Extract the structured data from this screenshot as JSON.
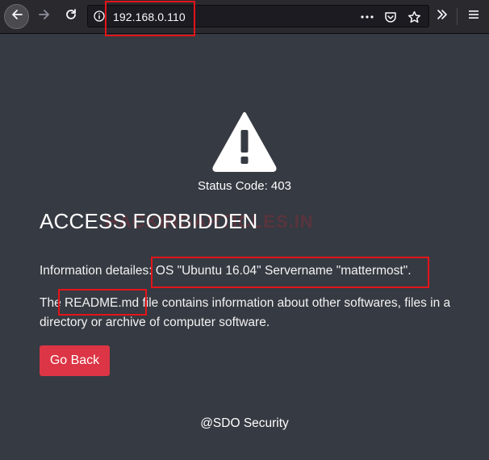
{
  "browser": {
    "url": "192.168.0.110",
    "icons": {
      "back": "arrow-left-icon",
      "forward": "arrow-right-icon",
      "reload": "reload-icon",
      "info": "info-icon",
      "page_actions": "more-horizontal-icon",
      "pocket": "pocket-icon",
      "bookmark": "star-icon",
      "overflow": "double-chevron-icon",
      "menu": "hamburger-menu-icon"
    }
  },
  "page": {
    "status_code": "Status Code: 403",
    "heading": "ACCESS FORBIDDEN",
    "watermark": "HACKINGARTICLES.IN",
    "info_prefix": "Information detailes: ",
    "info_detail": "OS \"Ubuntu 16.04\" Servername \"mattermost\".",
    "readme_prefix": "The ",
    "readme_file": "README.md",
    "readme_rest": " file contains information about other softwares, files in a directory or archive of computer software.",
    "go_back_label": "Go Back",
    "footer": "@SDO Security"
  },
  "colors": {
    "page_background": "#363a42",
    "button": "#dc3545",
    "annotation": "#e4141a"
  }
}
